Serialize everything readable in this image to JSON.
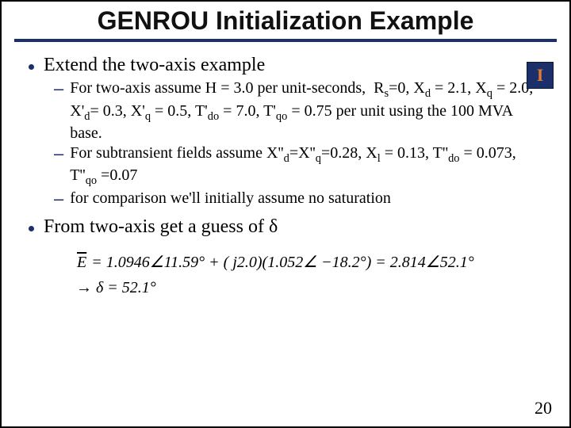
{
  "slide": {
    "title": "GENROU Initialization Example",
    "logo_glyph": "I",
    "bullets": [
      {
        "text": "Extend the two-axis example",
        "sub": [
          "For two-axis assume H = 3.0 per unit-seconds,  Rₛ=0, X_d = 2.1, X_q = 2.0, X'_d= 0.3, X'_q = 0.5, T'_do = 7.0, T'_qo = 0.75 per unit using the 100 MVA base.",
          "For subtransient fields assume X''_d=X''_q=0.28, X_l = 0.13, T''_do = 0.073, T''_qo =0.07",
          "for comparison we'll initially assume no saturation"
        ]
      },
      {
        "text": "From two-axis get a guess of δ",
        "sub": []
      }
    ],
    "formula": {
      "line1_prefix": "E",
      "line1_body": " = 1.0946∠11.59° + ( j2.0)(1.052∠ −18.2°) = 2.814∠52.1°",
      "line2": "→ δ = 52.1°"
    },
    "page_number": "20"
  }
}
